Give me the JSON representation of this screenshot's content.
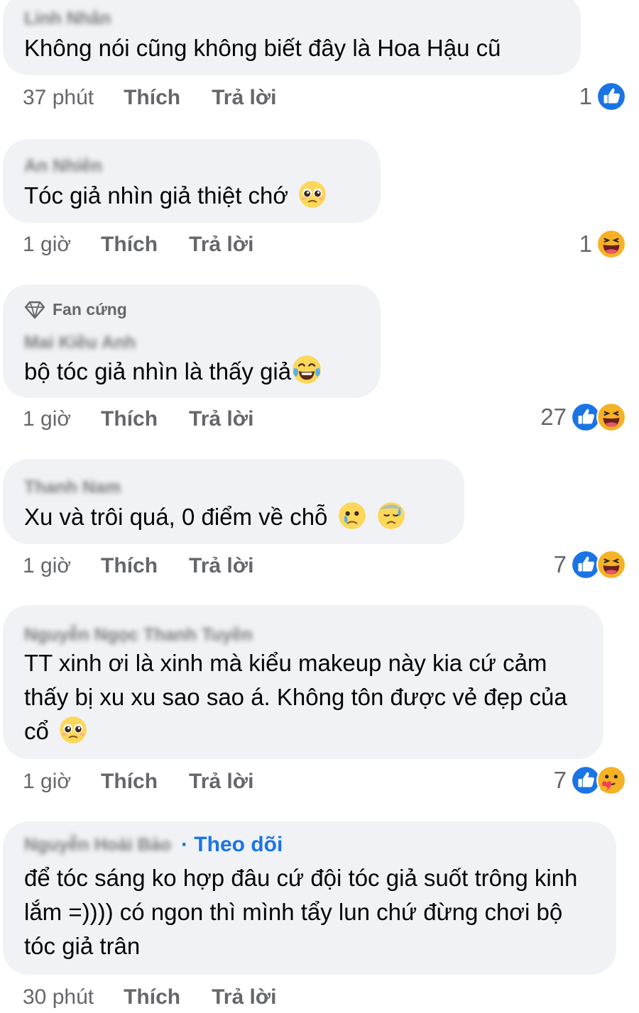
{
  "colors": {
    "bubble": "#f0f2f5",
    "meta": "#65676b",
    "like": "#1b74e4",
    "haha": "#f7b125"
  },
  "comments": [
    {
      "author": "Linh Nhân",
      "text": "Không nói cũng không biết đây là Hoa Hậu cũ",
      "time": "37 phút",
      "like": "Thích",
      "reply": "Trả lời",
      "count": "1",
      "reactions": [
        "like-icon"
      ]
    },
    {
      "author": "An Nhiên",
      "text": "Tóc giả nhìn giả thiệt chớ",
      "emoji": [
        "pleading-face-icon"
      ],
      "time": "1 giờ",
      "like": "Thích",
      "reply": "Trả lời",
      "count": "1",
      "reactions": [
        "haha-icon"
      ]
    },
    {
      "badge": "Fan cứng",
      "author": "Mai Kiều Anh",
      "text": "bộ tóc giả nhìn là thấy giả",
      "emoji": [
        "tears-of-joy-icon"
      ],
      "time": "1 giờ",
      "like": "Thích",
      "reply": "Trả lời",
      "count": "27",
      "reactions": [
        "like-icon",
        "haha-icon"
      ]
    },
    {
      "author": "Thanh Nam",
      "text": "Xu và trôi quá, 0 điểm về chỗ",
      "emoji": [
        "holding-back-tears-icon",
        "downcast-sweat-icon"
      ],
      "time": "1 giờ",
      "like": "Thích",
      "reply": "Trả lời",
      "count": "7",
      "reactions": [
        "like-icon",
        "haha-icon"
      ]
    },
    {
      "author": "Nguyễn Ngọc Thanh Tuyền",
      "text": "TT xinh ơi là xinh mà kiểu makeup này kia cứ cảm thấy bị xu xu sao sao á. Không tôn được vẻ đẹp của cổ",
      "emoji": [
        "pleading-face-icon"
      ],
      "time": "1 giờ",
      "like": "Thích",
      "reply": "Trả lời",
      "count": "7",
      "reactions": [
        "like-icon",
        "care-icon"
      ]
    },
    {
      "author": "Nguyễn Hoài Bảo",
      "follow": "· Theo dõi",
      "text": "để tóc sáng ko hợp đâu cứ đội tóc giả suốt trông kinh lắm =)))) có ngon thì mình tẩy lun chứ đừng chơi bộ tóc giả trân",
      "time": "30 phút",
      "like": "Thích",
      "reply": "Trả lời"
    }
  ]
}
